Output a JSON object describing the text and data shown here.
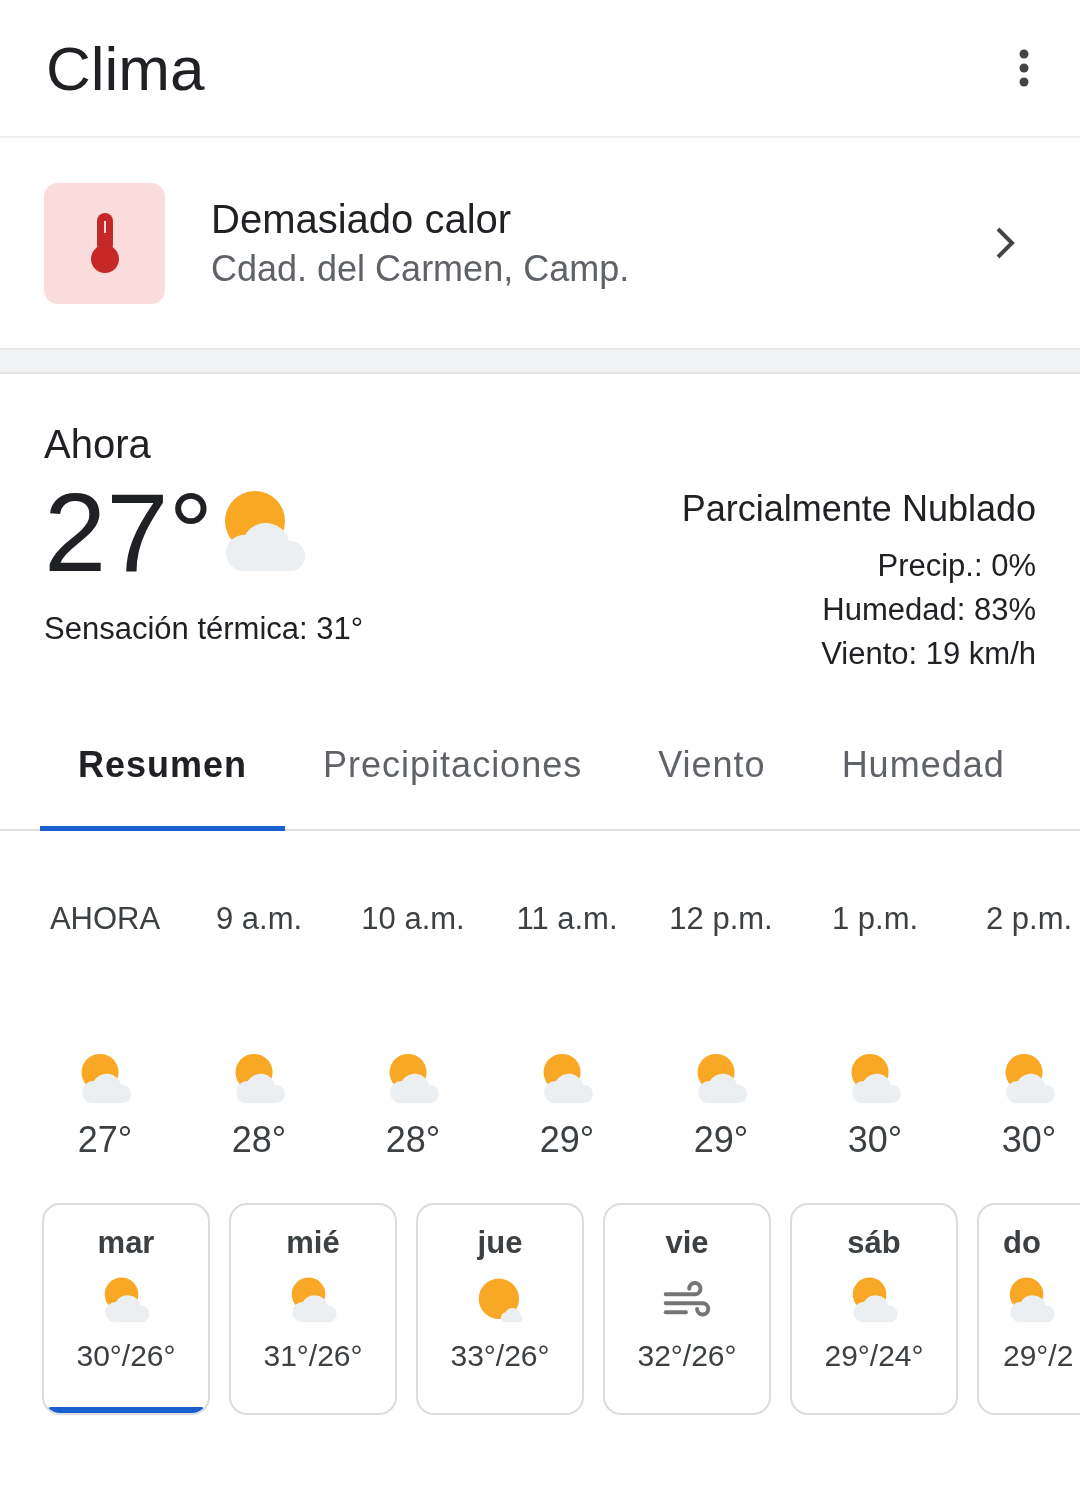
{
  "app_bar": {
    "title": "Clima"
  },
  "alert": {
    "title": "Demasiado calor",
    "location": "Cdad. del Carmen, Camp."
  },
  "now": {
    "label": "Ahora",
    "temperature": "27°",
    "kind": "partly-cloudy",
    "feels_like": "Sensación térmica: 31°",
    "condition": "Parcialmente Nublado",
    "details": [
      "Precip.: 0%",
      "Humedad: 83%",
      "Viento: 19 km/h"
    ]
  },
  "tabs": [
    {
      "label": "Resumen",
      "selected": true
    },
    {
      "label": "Precipitaciones",
      "selected": false
    },
    {
      "label": "Viento",
      "selected": false
    },
    {
      "label": "Humedad",
      "selected": false
    }
  ],
  "hourly": [
    {
      "time": "AHORA",
      "kind": "partly-cloudy",
      "temp": "27°"
    },
    {
      "time": "9 a.m.",
      "kind": "partly-cloudy",
      "temp": "28°"
    },
    {
      "time": "10 a.m.",
      "kind": "partly-cloudy",
      "temp": "28°"
    },
    {
      "time": "11 a.m.",
      "kind": "partly-cloudy",
      "temp": "29°"
    },
    {
      "time": "12 p.m.",
      "kind": "partly-cloudy",
      "temp": "29°"
    },
    {
      "time": "1 p.m.",
      "kind": "partly-cloudy",
      "temp": "30°"
    },
    {
      "time": "2 p.m.",
      "kind": "partly-cloudy",
      "temp": "30°"
    }
  ],
  "daily": [
    {
      "day": "mar",
      "kind": "partly-cloudy",
      "range": "30°/26°",
      "selected": true
    },
    {
      "day": "mié",
      "kind": "partly-cloudy",
      "range": "31°/26°",
      "selected": false
    },
    {
      "day": "jue",
      "kind": "mostly-sunny",
      "range": "33°/26°",
      "selected": false
    },
    {
      "day": "vie",
      "kind": "wind",
      "range": "32°/26°",
      "selected": false
    },
    {
      "day": "sáb",
      "kind": "partly-cloudy",
      "range": "29°/24°",
      "selected": false
    },
    {
      "day": "do",
      "kind": "partly-cloudy",
      "range": "29°/2",
      "selected": false
    }
  ]
}
